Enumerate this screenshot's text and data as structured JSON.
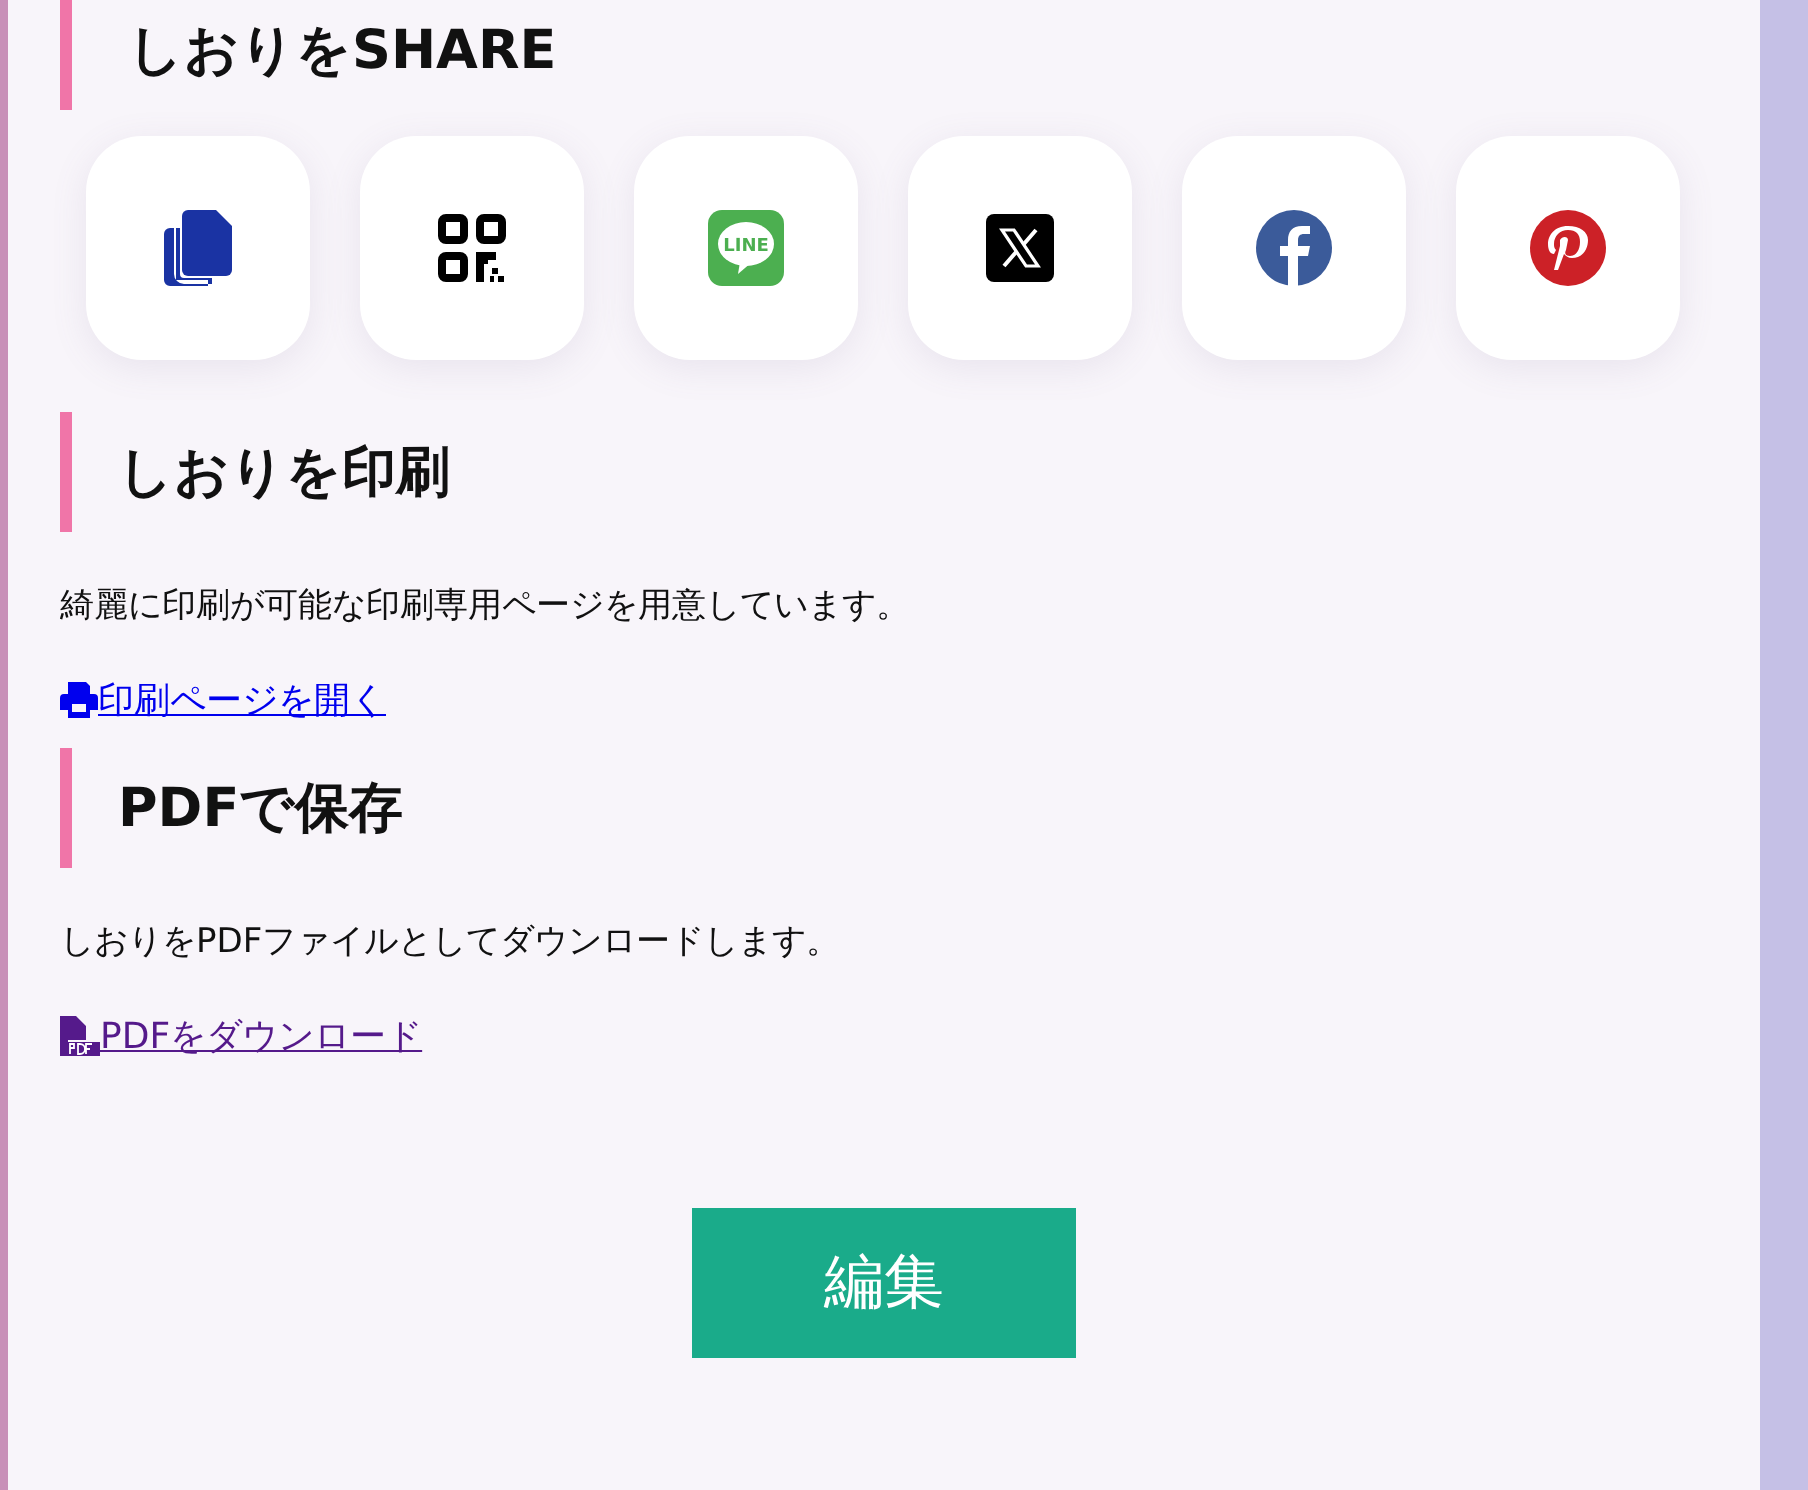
{
  "sections": [
    {
      "kind": "share",
      "heading": "しおりをSHARE",
      "buttons": [
        {
          "kind": "copy"
        },
        {
          "kind": "qr"
        },
        {
          "kind": "line",
          "logo_text": "LINE"
        },
        {
          "kind": "x"
        },
        {
          "kind": "facebook"
        },
        {
          "kind": "pinterest"
        }
      ]
    },
    {
      "kind": "text",
      "heading": "しおりを印刷",
      "description": "綺麗に印刷が可能な印刷専用ページを用意しています。",
      "link": {
        "kind": "print",
        "label": "印刷ページを開く",
        "visited": false
      }
    },
    {
      "kind": "text",
      "heading": "PDFで保存",
      "description": "しおりをPDFファイルとしてダウンロードします。",
      "link": {
        "kind": "pdf",
        "label": "PDFをダウンロード",
        "visited": true
      }
    }
  ],
  "edit_button": "編集"
}
